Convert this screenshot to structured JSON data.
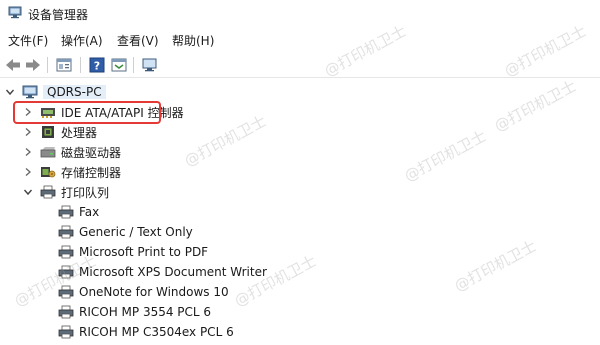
{
  "window": {
    "title": "设备管理器"
  },
  "menu": [
    {
      "label": "文件(F)"
    },
    {
      "label": "操作(A)"
    },
    {
      "label": "查看(V)"
    },
    {
      "label": "帮助(H)"
    }
  ],
  "tree": {
    "root": "QDRS-PC",
    "categories": [
      {
        "label": "IDE ATA/ATAPI 控制器",
        "expanded": false,
        "icon": "ide-controller-icon"
      },
      {
        "label": "处理器",
        "expanded": false,
        "icon": "processor-icon"
      },
      {
        "label": "磁盘驱动器",
        "expanded": false,
        "icon": "disk-drive-icon"
      },
      {
        "label": "存储控制器",
        "expanded": false,
        "icon": "storage-controller-icon"
      },
      {
        "label": "打印队列",
        "expanded": true,
        "icon": "printer-queue-icon"
      }
    ],
    "print_queue_items": [
      "Fax",
      "Generic / Text Only",
      "Microsoft Print to PDF",
      "Microsoft XPS Document Writer",
      "OneNote for Windows 10",
      "RICOH MP 3554 PCL 6",
      "RICOH MP C3504ex PCL 6"
    ]
  },
  "watermark": "@打印机卫士",
  "colors": {
    "highlight_border": "#e53935",
    "selection": "#e4eef9"
  }
}
